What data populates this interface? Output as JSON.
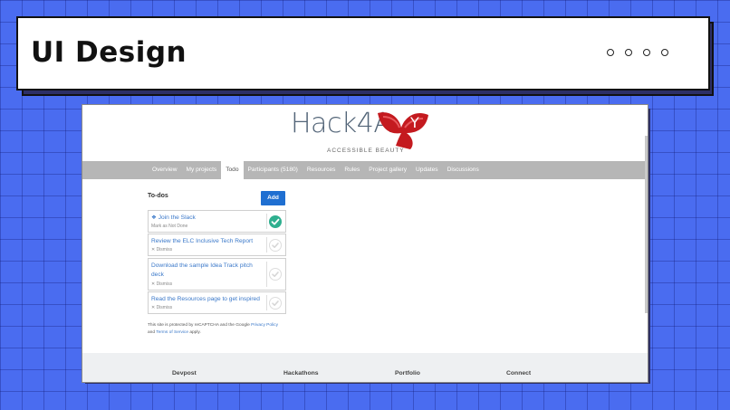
{
  "banner": {
    "title": "UI Design"
  },
  "logo": {
    "text": "Hack4A",
    "subtitle": "ACCESSIBLE BEAUTY"
  },
  "nav": {
    "items": [
      {
        "label": "Overview",
        "active": false
      },
      {
        "label": "My projects",
        "active": false
      },
      {
        "label": "Todo",
        "active": true
      },
      {
        "label": "Participants (5180)",
        "active": false
      },
      {
        "label": "Resources",
        "active": false
      },
      {
        "label": "Rules",
        "active": false
      },
      {
        "label": "Project gallery",
        "active": false
      },
      {
        "label": "Updates",
        "active": false
      },
      {
        "label": "Discussions",
        "active": false
      }
    ]
  },
  "todos": {
    "title": "To-dos",
    "add_label": "Add",
    "items": [
      {
        "label": "Join the Slack",
        "sub": "Mark as Not Done",
        "done": true
      },
      {
        "label": "Review the ELC Inclusive Tech Report",
        "sub": "✕ Dismiss",
        "done": false
      },
      {
        "label": "Download the sample Idea Track pitch deck",
        "sub": "✕ Dismiss",
        "done": false
      },
      {
        "label": "Read the Resources page to get inspired",
        "sub": "✕ Dismiss",
        "done": false
      }
    ]
  },
  "recaptcha": {
    "prefix": "This site is protected by reCAPTCHA and the Google",
    "privacy": "Privacy Policy",
    "and": "and",
    "terms": "Terms of Service",
    "suffix": "apply."
  },
  "footer": {
    "columns": [
      "Devpost",
      "Hackathons",
      "Portfolio",
      "Connect"
    ]
  },
  "colors": {
    "accent": "#1f6fd1",
    "done": "#2eaf8f",
    "link": "#3a78c9",
    "background": "#4a6cf0"
  }
}
